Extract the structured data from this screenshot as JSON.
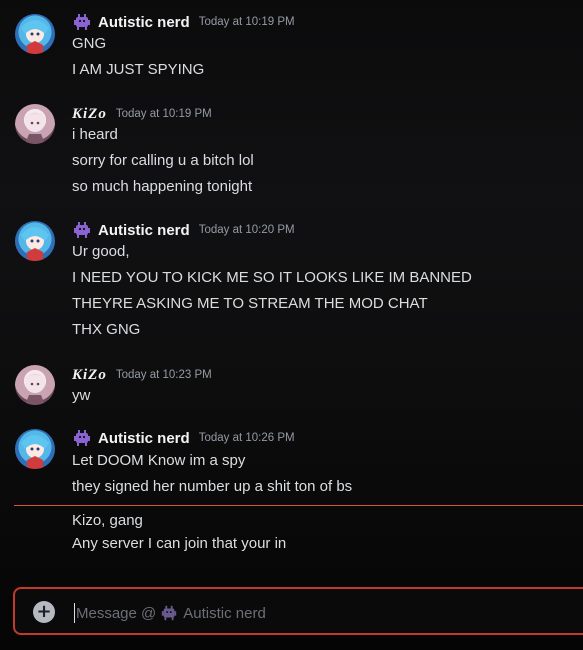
{
  "messages": [
    {
      "author": "Autistic nerd",
      "avatar": "nerd",
      "timestamp": "Today at 10:19 PM",
      "lines": [
        "GNG",
        "I AM JUST SPYING"
      ]
    },
    {
      "author": "KiZo",
      "avatar": "kizo",
      "timestamp": "Today at 10:19 PM",
      "lines": [
        "i heard",
        "sorry for calling u a bitch lol",
        "so much happening tonight"
      ]
    },
    {
      "author": "Autistic nerd",
      "avatar": "nerd",
      "timestamp": "Today at 10:20 PM",
      "lines": [
        "Ur good,",
        "I NEED YOU TO KICK ME SO IT LOOKS LIKE IM BANNED",
        "THEYRE ASKING ME TO STREAM THE MOD CHAT",
        "THX GNG"
      ]
    },
    {
      "author": "KiZo",
      "avatar": "kizo",
      "timestamp": "Today at 10:23 PM",
      "lines": [
        "yw"
      ]
    },
    {
      "author": "Autistic nerd",
      "avatar": "nerd",
      "timestamp": "Today at 10:26 PM",
      "lines": [
        "Let DOOM Know im a spy",
        "they signed her number up a shit ton of bs"
      ]
    }
  ],
  "new_messages": [
    "Kizo, gang",
    "Any server I can join that your in"
  ],
  "composer": {
    "placeholder_prefix": "Message @",
    "placeholder_name": "Autistic nerd",
    "add_icon": "plus-circle-icon"
  },
  "icons": {
    "nerd_badge": "alien-monster-icon"
  },
  "colors": {
    "divider": "#e04c3c",
    "composer_border": "#c23a2b",
    "badge": "#8a63d2"
  }
}
